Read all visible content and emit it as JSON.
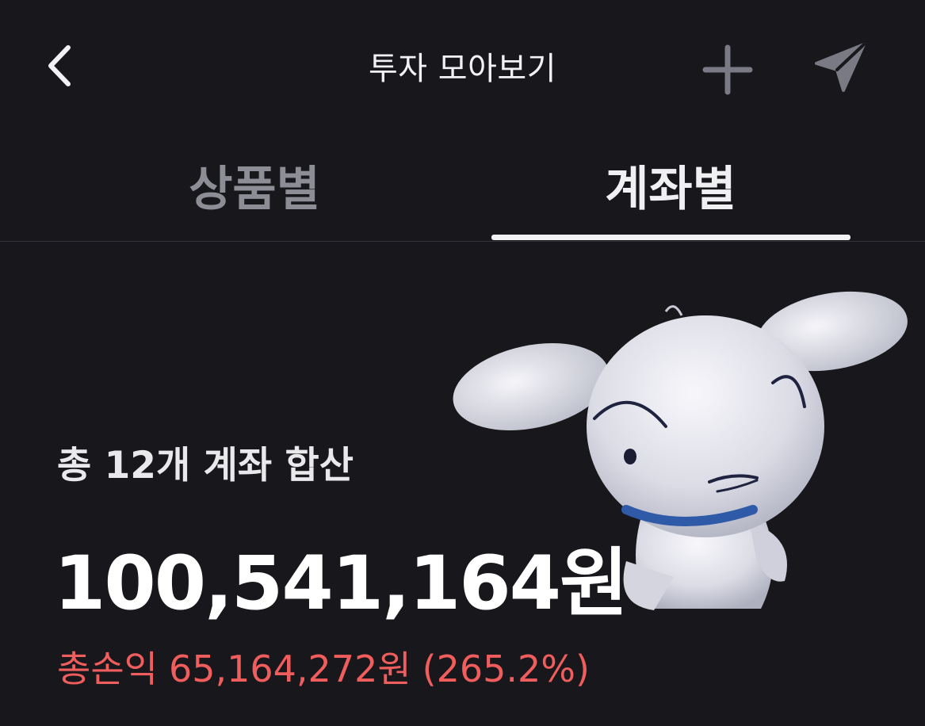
{
  "header": {
    "title": "투자 모아보기",
    "back_icon": "chevron-left-icon",
    "add_icon": "plus-icon",
    "send_icon": "send-icon"
  },
  "tabs": [
    {
      "label": "상품별",
      "active": false
    },
    {
      "label": "계좌별",
      "active": true
    }
  ],
  "summary": {
    "label": "총 12개 계좌 합산",
    "total": "100,541,164원",
    "pnl_label": "총손익",
    "pnl_amount": "65,164,272원",
    "pnl_rate": "(265.2%)"
  },
  "colors": {
    "background": "#17171c",
    "loss_gain_red": "#ef5d5d",
    "inactive_tab": "#8d8d96"
  }
}
